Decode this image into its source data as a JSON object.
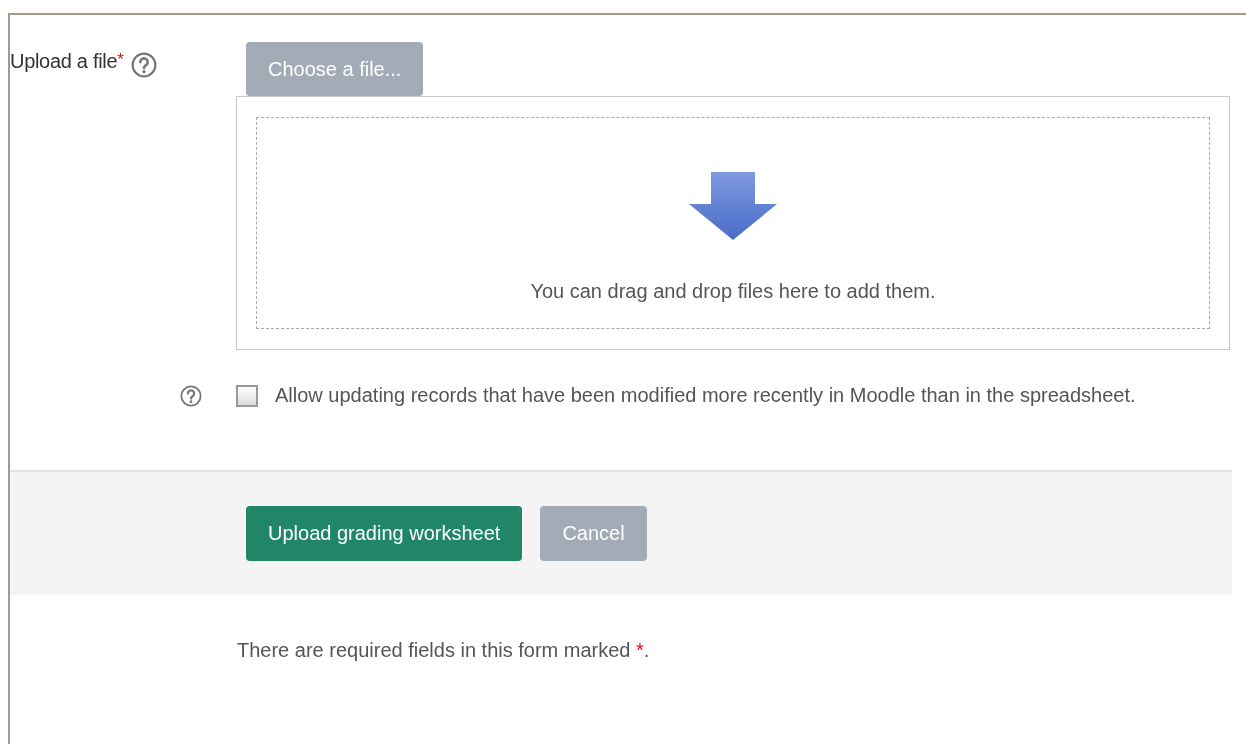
{
  "file_field": {
    "label": "Upload a file",
    "required": true,
    "required_mark": "*",
    "button": "Choose a file...",
    "drop_hint": "You can drag and drop files here to add them."
  },
  "option": {
    "checked": false,
    "label": "Allow updating records that have been modified more recently in Moodle than in the spreadsheet."
  },
  "buttons": [
    {
      "label": "Upload grading worksheet",
      "kind": "primary"
    },
    {
      "label": "Cancel",
      "kind": "secondary"
    }
  ],
  "note": {
    "text": "There are required fields in this form marked",
    "mark": "*",
    "end": "."
  }
}
